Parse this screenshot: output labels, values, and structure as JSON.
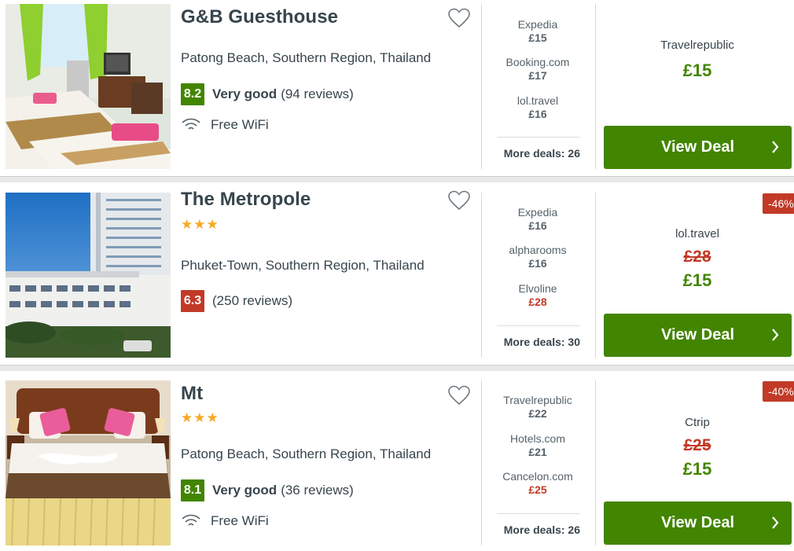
{
  "hotels": [
    {
      "name": "G&B Guesthouse",
      "stars": "",
      "location": "Patong Beach, Southern Region, Thailand",
      "score": "8.2",
      "rating_word": "Very good",
      "reviews": "(94 reviews)",
      "amenity": "Free WiFi",
      "deals": [
        {
          "provider": "Expedia",
          "price": "£15"
        },
        {
          "provider": "Booking.com",
          "price": "£17"
        },
        {
          "provider": "lol.travel",
          "price": "£16"
        }
      ],
      "more_deals": "More deals: 26",
      "best_provider": "Travelrepublic",
      "old_price": "",
      "best_price": "£15",
      "discount": "",
      "cta": "View Deal"
    },
    {
      "name": "The Metropole",
      "stars": "★★★",
      "location": "Phuket-Town, Southern Region, Thailand",
      "score": "6.3",
      "rating_word": "",
      "reviews": "(250 reviews)",
      "amenity": "",
      "deals": [
        {
          "provider": "Expedia",
          "price": "£16"
        },
        {
          "provider": "alpharooms",
          "price": "£16"
        },
        {
          "provider": "Elvoline",
          "price": "£28"
        }
      ],
      "more_deals": "More deals: 30",
      "best_provider": "lol.travel",
      "old_price": "£28",
      "best_price": "£15",
      "discount": "-46%",
      "cta": "View Deal"
    },
    {
      "name": "Mt",
      "stars": "★★★",
      "location": "Patong Beach, Southern Region, Thailand",
      "score": "8.1",
      "rating_word": "Very good",
      "reviews": "(36 reviews)",
      "amenity": "Free WiFi",
      "deals": [
        {
          "provider": "Travelrepublic",
          "price": "£22"
        },
        {
          "provider": "Hotels.com",
          "price": "£21"
        },
        {
          "provider": "Cancelon.com",
          "price": "£25"
        }
      ],
      "more_deals": "More deals: 26",
      "best_provider": "Ctrip",
      "old_price": "£25",
      "best_price": "£15",
      "discount": "-40%",
      "cta": "View Deal"
    }
  ],
  "colors": {
    "green": "#428500",
    "red": "#c23a27",
    "star": "#f7a823"
  },
  "icons": [
    "heart-icon",
    "wifi-icon",
    "chevron-right-icon"
  ]
}
